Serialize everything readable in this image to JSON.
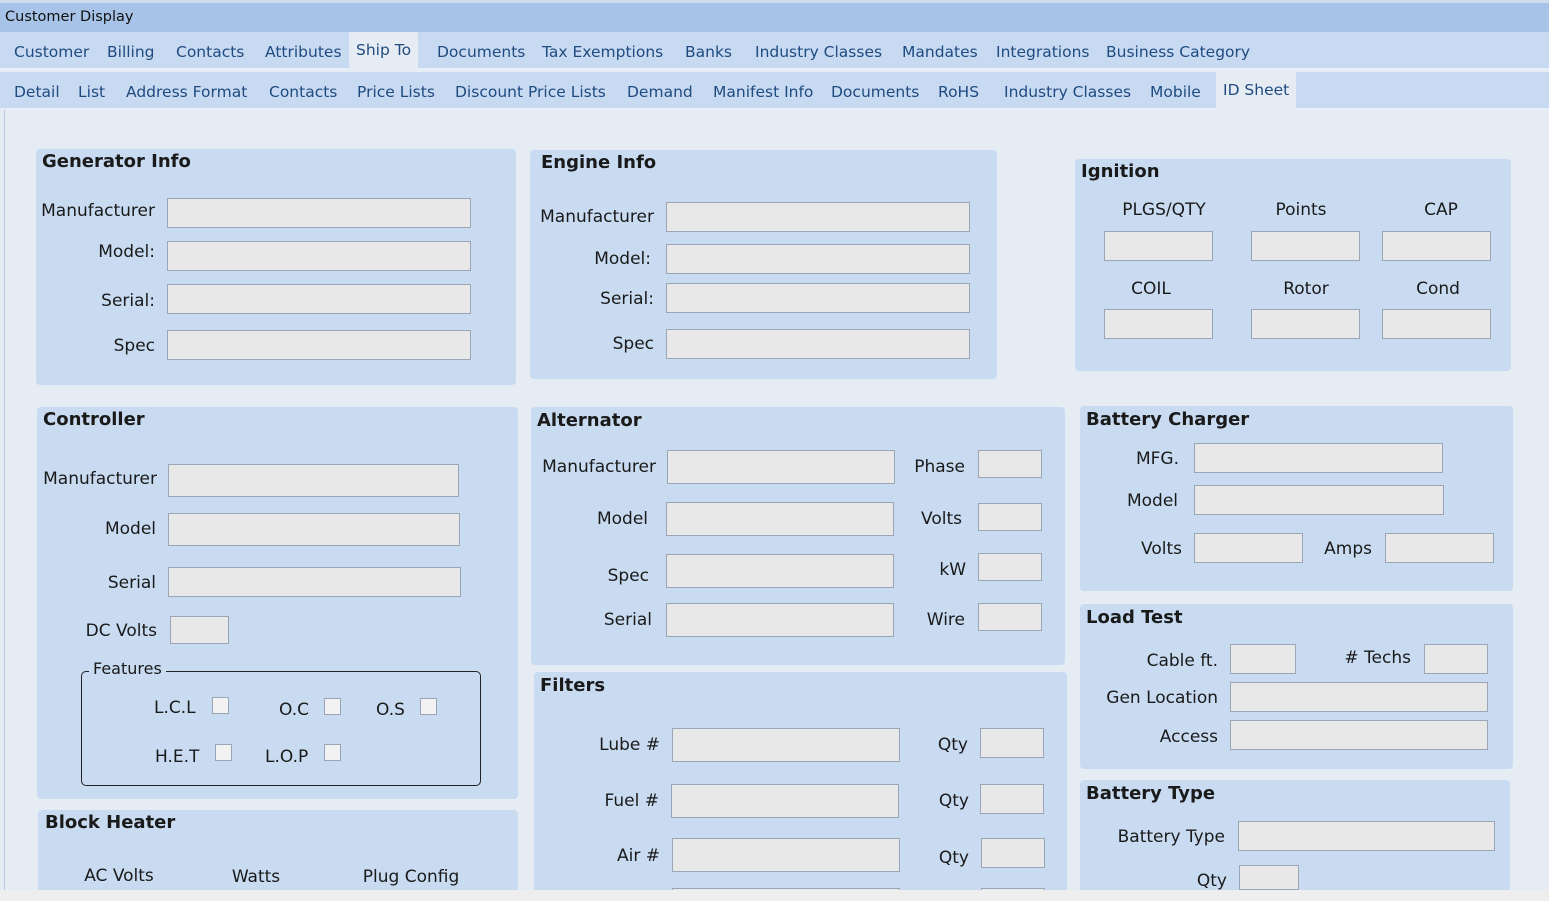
{
  "window": {
    "title": "Customer Display"
  },
  "main_tabs": [
    "Customer",
    "Billing",
    "Contacts",
    "Attributes",
    "Ship To",
    "Documents",
    "Tax Exemptions",
    "Banks",
    "Industry Classes",
    "Mandates",
    "Integrations",
    "Business Category"
  ],
  "sub_tabs": [
    "Detail",
    "List",
    "Address Format",
    "Contacts",
    "Price Lists",
    "Discount Price Lists",
    "Demand",
    "Manifest Info",
    "Documents",
    "RoHS",
    "Industry Classes",
    "Mobile",
    "ID Sheet"
  ],
  "generator": {
    "title": "Generator Info",
    "manufacturer": "Manufacturer",
    "model": "Model:",
    "serial": "Serial:",
    "spec": "Spec"
  },
  "engine": {
    "title": "Engine Info",
    "manufacturer": "Manufacturer",
    "model": "Model:",
    "serial": "Serial:",
    "spec": "Spec"
  },
  "ignition": {
    "title": "Ignition",
    "plgs": "PLGS/QTY",
    "points": "Points",
    "cap": "CAP",
    "coil": "COIL",
    "rotor": "Rotor",
    "cond": "Cond"
  },
  "controller": {
    "title": "Controller",
    "manufacturer": "Manufacturer",
    "model": "Model",
    "serial": "Serial",
    "dc_volts": "DC Volts",
    "features": {
      "legend": "Features",
      "lcl": "L.C.L",
      "oc": "O.C",
      "os": "O.S",
      "het": "H.E.T",
      "lop": "L.O.P"
    }
  },
  "alternator": {
    "title": "Alternator",
    "manufacturer": "Manufacturer",
    "model": "Model",
    "spec": "Spec",
    "serial": "Serial",
    "phase": "Phase",
    "volts": "Volts",
    "kw": "kW",
    "wire": "Wire"
  },
  "battery_charger": {
    "title": "Battery Charger",
    "mfg": "MFG.",
    "model": "Model",
    "volts": "Volts",
    "amps": "Amps"
  },
  "load_test": {
    "title": "Load Test",
    "cable": "Cable ft.",
    "techs": "# Techs",
    "gen_location": "Gen Location",
    "access": "Access"
  },
  "filters": {
    "title": "Filters",
    "lube": "Lube #",
    "fuel": "Fuel #",
    "air": "Air #",
    "qty": "Qty"
  },
  "battery_type": {
    "title": "Battery Type",
    "type": "Battery Type",
    "qty": "Qty"
  },
  "block_heater": {
    "title": "Block Heater",
    "ac_volts": "AC Volts",
    "watts": "Watts",
    "plug_config": "Plug Config"
  }
}
